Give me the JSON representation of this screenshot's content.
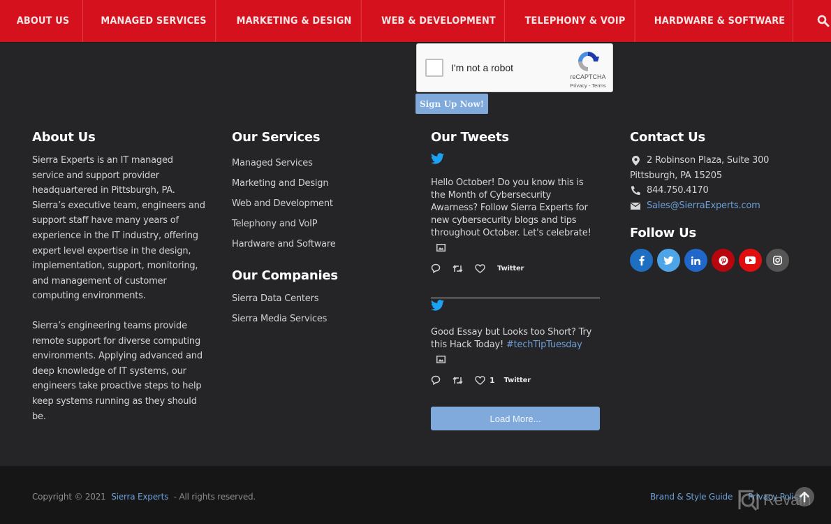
{
  "nav": {
    "items": [
      {
        "label": "ABOUT US"
      },
      {
        "label": "MANAGED SERVICES"
      },
      {
        "label": "MARKETING & DESIGN"
      },
      {
        "label": "WEB & DEVELOPMENT"
      },
      {
        "label": "TELEPHONY & VOIP"
      },
      {
        "label": "HARDWARE & SOFTWARE"
      }
    ],
    "search_icon": "search-icon",
    "brand_color": "#d6111e"
  },
  "recaptcha": {
    "label": "I'm not a robot",
    "brand": "reCAPTCHA",
    "privacy": "Privacy",
    "separator": " - ",
    "terms": "Terms"
  },
  "signup": {
    "button_label": "Sign Up Now!"
  },
  "about": {
    "title": "About Us",
    "paragraphs": [
      "Sierra Experts is an IT managed service and support provider headquartered in Pittsburgh, PA. Sierra’s executive team, engineers and support staff have many years of experience in the IT industry, offering expert level expertise in the design, implementation, support, monitoring, and management of customer computing environments.",
      "Sierra’s engineering teams provide remote support for diverse computing environments. Applying advanced and deep knowledge of IT systems, our engineers take proactive steps to help keep systems running as they should be."
    ]
  },
  "services": {
    "title": "Our Services",
    "items": [
      "Managed Services",
      "Marketing and Design",
      "Web and Development",
      "Telephony and VoIP",
      "Hardware and Software"
    ]
  },
  "companies": {
    "title": "Our Companies",
    "items": [
      "Sierra Data Centers",
      "Sierra Media Services"
    ]
  },
  "tweets": {
    "title": "Our Tweets",
    "items": [
      {
        "text": "Hello October! Do you know this is the Month of Cybersecurity Awarness? Follow Sierra Experts for new cybersecurity blogs and tips throughout October. Let's celebrate!",
        "hashtag": "",
        "likes": "",
        "source": "Twitter"
      },
      {
        "text": "Good Essay but Looks too Short? Try this Hack Today! ",
        "hashtag": "#techTipTuesday",
        "likes": "1",
        "source": "Twitter"
      }
    ],
    "load_more_label": "Load More..."
  },
  "contact": {
    "title": "Contact Us",
    "address_line1": "2 Robinson Plaza, Suite 300",
    "address_line2": "Pittsburgh, PA 15205",
    "phone": "844.750.4170",
    "email": "Sales@SierraExperts.com"
  },
  "follow": {
    "title": "Follow Us",
    "networks": [
      {
        "name": "facebook",
        "glyph": "f",
        "color": "#1e6fc2"
      },
      {
        "name": "twitter",
        "glyph": "t",
        "color": "#4da4e6"
      },
      {
        "name": "linkedin",
        "glyph": "in",
        "color": "#2067c9"
      },
      {
        "name": "pinterest",
        "glyph": "p",
        "color": "#b8060f"
      },
      {
        "name": "youtube",
        "glyph": "yt",
        "color": "#e00e0e"
      },
      {
        "name": "instagram",
        "glyph": "ig",
        "color": "#555555"
      }
    ]
  },
  "footer": {
    "copyright_prefix": "Copyright © 2021",
    "company_link": "Sierra Experts",
    "copyright_suffix": "- All rights reserved.",
    "brand_guide": "Brand & Style Guide",
    "separator": "|",
    "privacy_policy": "Privacy Policy",
    "watermark": "Revain"
  },
  "colors": {
    "background": "#252527",
    "footer_bottom": "#161616",
    "link": "#6d9fd6",
    "button": "#7faadb",
    "twitter": "#1da1f2"
  }
}
